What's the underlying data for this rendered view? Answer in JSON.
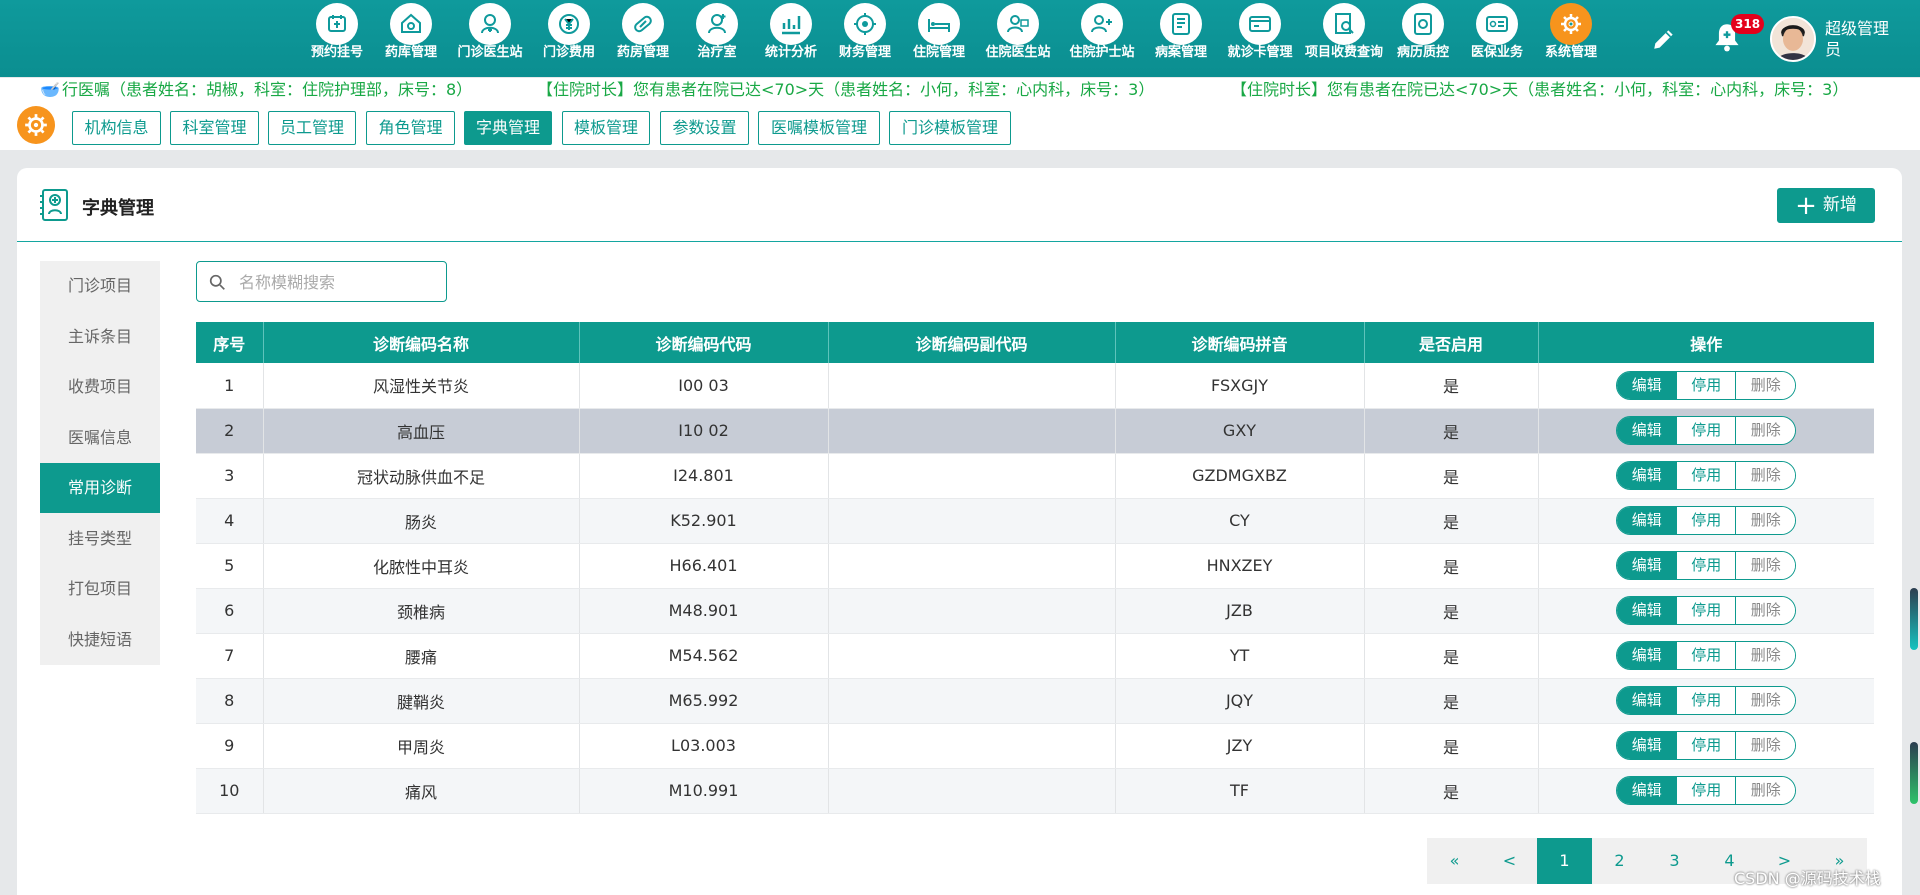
{
  "nav": [
    {
      "label": "预约挂号",
      "icon": "register-icon"
    },
    {
      "label": "药库管理",
      "icon": "warehouse-icon"
    },
    {
      "label": "门诊医生站",
      "icon": "doctor-icon"
    },
    {
      "label": "门诊费用",
      "icon": "yen-icon"
    },
    {
      "label": "药房管理",
      "icon": "pill-icon"
    },
    {
      "label": "治疗室",
      "icon": "nurse-icon"
    },
    {
      "label": "统计分析",
      "icon": "chart-icon"
    },
    {
      "label": "财务管理",
      "icon": "finance-icon"
    },
    {
      "label": "住院管理",
      "icon": "bed-icon"
    },
    {
      "label": "住院医生站",
      "icon": "inpatient-doctor-icon"
    },
    {
      "label": "住院护士站",
      "icon": "inpatient-nurse-icon"
    },
    {
      "label": "病案管理",
      "icon": "record-icon"
    },
    {
      "label": "就诊卡管理",
      "icon": "card-icon"
    },
    {
      "label": "项目收费查询",
      "icon": "query-icon"
    },
    {
      "label": "病历质控",
      "icon": "quality-icon"
    },
    {
      "label": "医保业务",
      "icon": "insurance-icon"
    },
    {
      "label": "系统管理",
      "icon": "gear-icon"
    }
  ],
  "header": {
    "bell_count": "318",
    "user_name": "超级管理员"
  },
  "notices": [
    "行医嘱（患者姓名：胡椒，科室：住院护理部，床号：8）",
    "【住院时长】您有患者在院已达<70>天（患者姓名：小何，科室：心内科，床号：3）",
    "【住院时长】您有患者在院已达<70>天（患者姓名：小何，科室：心内科，床号：3）"
  ],
  "tabs": [
    {
      "label": "机构信息"
    },
    {
      "label": "科室管理"
    },
    {
      "label": "员工管理"
    },
    {
      "label": "角色管理"
    },
    {
      "label": "字典管理"
    },
    {
      "label": "模板管理"
    },
    {
      "label": "参数设置"
    },
    {
      "label": "医嘱模板管理"
    },
    {
      "label": "门诊模板管理"
    }
  ],
  "page": {
    "title": "字典管理",
    "add_label": "新增",
    "search_placeholder": "名称模糊搜索"
  },
  "side_menu": [
    {
      "label": "门诊项目"
    },
    {
      "label": "主诉条目"
    },
    {
      "label": "收费项目"
    },
    {
      "label": "医嘱信息"
    },
    {
      "label": "常用诊断"
    },
    {
      "label": "挂号类型"
    },
    {
      "label": "打包项目"
    },
    {
      "label": "快捷短语"
    }
  ],
  "table": {
    "headers": [
      "序号",
      "诊断编码名称",
      "诊断编码代码",
      "诊断编码副代码",
      "诊断编码拼音",
      "是否启用",
      "操作"
    ],
    "rows": [
      {
        "no": "1",
        "name": "风湿性关节炎",
        "code": "I00 03",
        "subcode": "",
        "pinyin": "FSXGJY",
        "enabled": "是"
      },
      {
        "no": "2",
        "name": "高血压",
        "code": "I10 02",
        "subcode": "",
        "pinyin": "GXY",
        "enabled": "是"
      },
      {
        "no": "3",
        "name": "冠状动脉供血不足",
        "code": "I24.801",
        "subcode": "",
        "pinyin": "GZDMGXBZ",
        "enabled": "是"
      },
      {
        "no": "4",
        "name": "肠炎",
        "code": "K52.901",
        "subcode": "",
        "pinyin": "CY",
        "enabled": "是"
      },
      {
        "no": "5",
        "name": "化脓性中耳炎",
        "code": "H66.401",
        "subcode": "",
        "pinyin": "HNXZEY",
        "enabled": "是"
      },
      {
        "no": "6",
        "name": "颈椎病",
        "code": "M48.901",
        "subcode": "",
        "pinyin": "JZB",
        "enabled": "是"
      },
      {
        "no": "7",
        "name": "腰痛",
        "code": "M54.562",
        "subcode": "",
        "pinyin": "YT",
        "enabled": "是"
      },
      {
        "no": "8",
        "name": "腱鞘炎",
        "code": "M65.992",
        "subcode": "",
        "pinyin": "JQY",
        "enabled": "是"
      },
      {
        "no": "9",
        "name": "甲周炎",
        "code": "L03.003",
        "subcode": "",
        "pinyin": "JZY",
        "enabled": "是"
      },
      {
        "no": "10",
        "name": "痛风",
        "code": "M10.991",
        "subcode": "",
        "pinyin": "TF",
        "enabled": "是"
      }
    ],
    "ops": {
      "edit": "编辑",
      "disable": "停用",
      "delete": "删除"
    }
  },
  "pager": {
    "first": "«",
    "prev": "<",
    "pages": [
      "1",
      "2",
      "3",
      "4"
    ],
    "next": ">",
    "last": "»"
  },
  "watermark": "CSDN @源码技术栈",
  "colors": {
    "primary": "#0d9a8e",
    "nav_bg": "#0f9a9c",
    "accent": "#f7941d",
    "notice_text": "#19a845",
    "badge": "#e4001b"
  }
}
